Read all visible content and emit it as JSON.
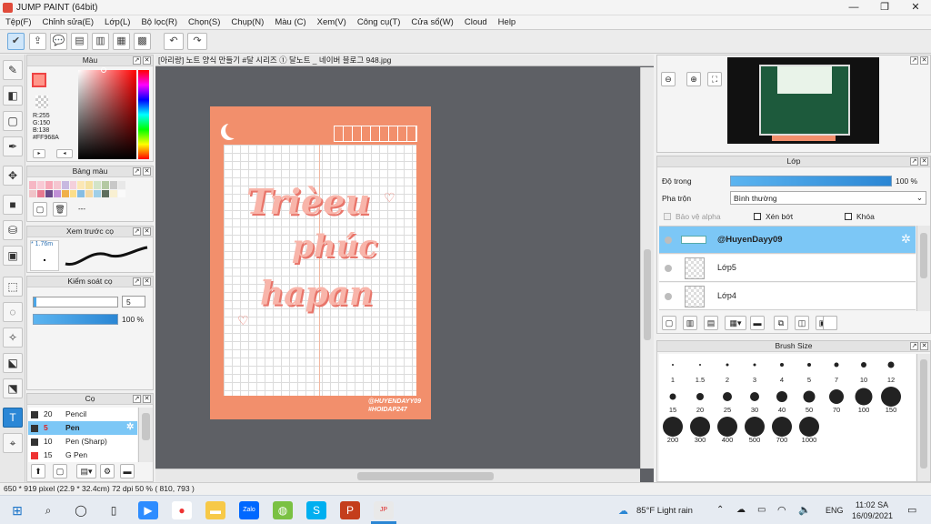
{
  "app": {
    "title": "JUMP PAINT (64bit)"
  },
  "menu": [
    "Tệp(F)",
    "Chỉnh sửa(E)",
    "Lớp(L)",
    "Bộ lọc(R)",
    "Chọn(S)",
    "Chụp(N)",
    "Màu (C)",
    "Xem(V)",
    "Công cụ(T)",
    "Cửa sổ(W)",
    "Cloud",
    "Help"
  ],
  "color_panel": {
    "title": "Màu",
    "r": "R:255",
    "g": "G:150",
    "b": "B:138",
    "hex": "#FF968A",
    "main_color": "#ff968a"
  },
  "swatch_panel": {
    "title": "Bảng màu",
    "dash": "---"
  },
  "brush_preview": {
    "title": "Xem trước cọ",
    "size": "* 1.76m"
  },
  "brush_control": {
    "title": "Kiểm soát cọ",
    "size_value": "5",
    "opacity_label": "100 %"
  },
  "brush_list": {
    "title": "Cọ",
    "items": [
      {
        "size": "20",
        "name": "Pencil"
      },
      {
        "size": "5",
        "name": "Pen"
      },
      {
        "size": "10",
        "name": "Pen (Sharp)"
      },
      {
        "size": "15",
        "name": "G Pen"
      }
    ]
  },
  "document": {
    "tab": "[아리랑] 노트 양식 만들기 #달 시리즈 ① 달노트 _ 네이버 블로그 948.jpg",
    "art_text_1": "Trièeu",
    "art_text_2": "phúc",
    "art_text_3": "hapan",
    "art_credit_1": "@HUYENDAYY09",
    "art_credit_2": "#HOIDAP247"
  },
  "layer_panel": {
    "title": "Lớp",
    "opacity_label": "Độ trong",
    "opacity_value": "100 %",
    "blend_label": "Pha trộn",
    "blend_value": "Bình thường",
    "protect_alpha": "Bảo vệ alpha",
    "clip": "Xén bớt",
    "lock": "Khóa",
    "layers": [
      "@HuyenDayy09",
      "Lớp5",
      "Lớp4"
    ]
  },
  "brush_size_panel": {
    "title": "Brush Size",
    "sizes": [
      "1",
      "1.5",
      "2",
      "3",
      "4",
      "5",
      "7",
      "10",
      "12",
      "15",
      "20",
      "25",
      "30",
      "40",
      "50",
      "70",
      "100",
      "150",
      "200",
      "300",
      "400",
      "500",
      "700",
      "1000"
    ]
  },
  "status": {
    "text": "650 * 919 pixel   (22.9 * 32.4cm)   72 dpi   50 %   ( 810, 793 )"
  },
  "taskbar": {
    "weather": "85°F  Light rain",
    "lang": "ENG",
    "time": "11:02 SA",
    "date": "16/09/2021"
  }
}
